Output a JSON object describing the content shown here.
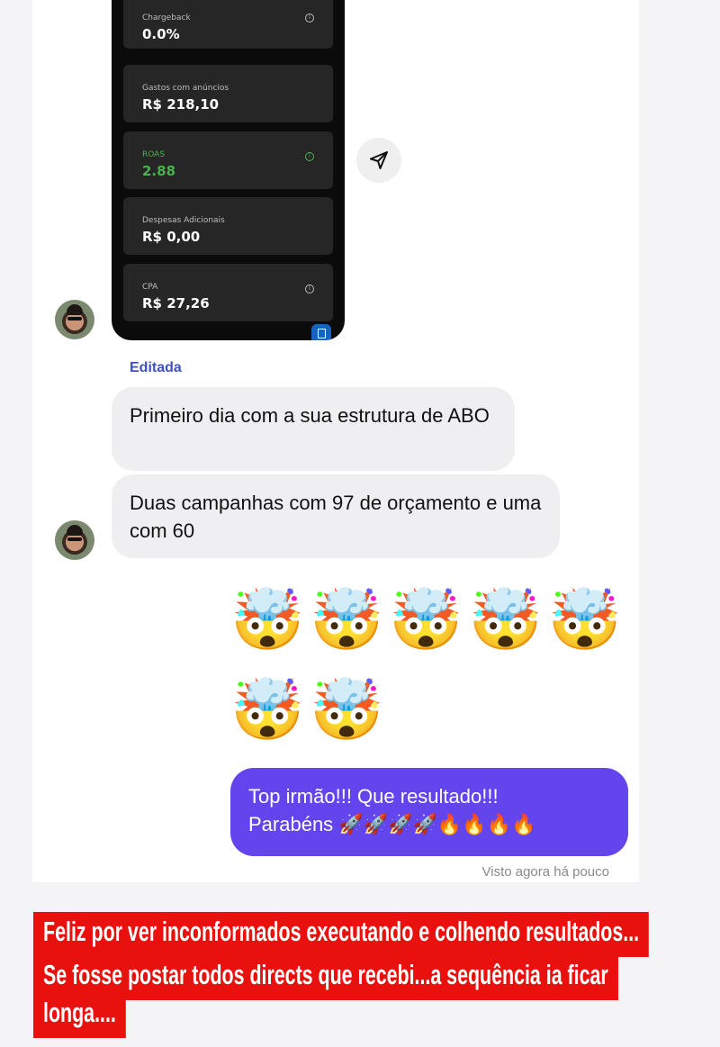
{
  "dashboard": {
    "cards": [
      {
        "label": "Chargeback",
        "value": "0.0%",
        "info": "i"
      },
      {
        "label": "Gastos com anúncios",
        "value": "R$ 218,10"
      },
      {
        "label": "ROAS",
        "value": "2.88",
        "info": "i",
        "highlight_color": "#4caf50"
      },
      {
        "label": "Despesas Adicionais",
        "value": "R$ 0,00"
      },
      {
        "label": "CPA",
        "value": "R$ 27,26",
        "info": "i"
      }
    ]
  },
  "chat": {
    "edited_label": "Editada",
    "incoming_messages": [
      "Primeiro dia com a sua estrutura de ABO",
      "Duas campanhas com 97 de orçamento e uma com 60"
    ],
    "emoji_rows": [
      "🤯🤯🤯🤯🤯",
      "🤯🤯"
    ],
    "outgoing_message_line1": "Top irmão!!! Que resultado!!!",
    "outgoing_message_line2": "Parabéns 🚀🚀🚀🚀🔥🔥🔥🔥",
    "seen_status": "Visto agora há pouco",
    "outgoing_bubble_color": "#6245ed"
  },
  "caption": {
    "lines": [
      "Feliz por ver inconformados executando e colhendo resultados...",
      "Se fosse postar todos directs que recebi...a sequência ia ficar",
      "longa...."
    ],
    "background_color": "#e8110d"
  }
}
